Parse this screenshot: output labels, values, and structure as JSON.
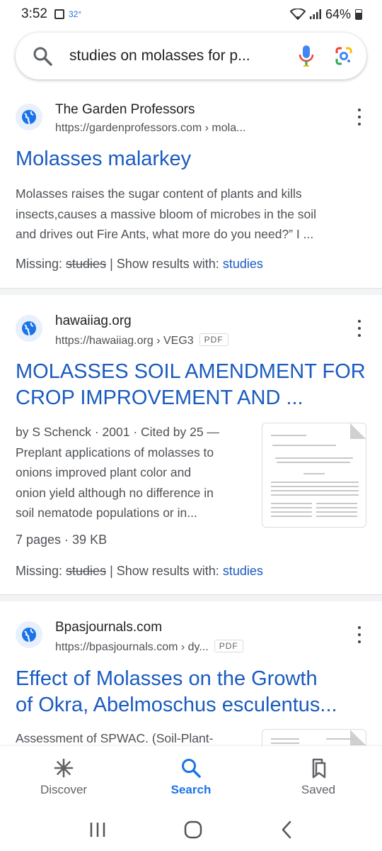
{
  "status_bar": {
    "time": "3:52",
    "temperature": "32°",
    "battery": "64%"
  },
  "search": {
    "query": "studies on molasses for p...",
    "search_icon": "search-icon",
    "mic_icon": "mic-icon",
    "lens_icon": "google-lens-icon"
  },
  "results": [
    {
      "site_name": "The Garden Professors",
      "url": "https://gardenprofessors.com › mola...",
      "title": "Molasses malarkey",
      "snippet": [
        "Molasses raises the sugar content of plants and kills",
        "insects,causes a massive bloom of microbes in the soil",
        "and drives out Fire Ants, what more do you need?” I ..."
      ],
      "missing_label": "Missing:",
      "missing_term": "studies",
      "show_results_label": " | Show results with: ",
      "show_results_link": "studies"
    },
    {
      "site_name": "hawaiiag.org",
      "url": "https://hawaiiag.org › VEG3",
      "file_type": "PDF",
      "title_lines": [
        "MOLASSES SOIL AMENDMENT FOR",
        "CROP IMPROVEMENT AND ..."
      ],
      "snippet": [
        "by S Schenck · 2001 · Cited by 25 —",
        "Preplant applications of molasses to",
        "onions improved plant color and",
        "onion yield although no difference in",
        "soil nematode populations or in..."
      ],
      "meta": "7 pages · 39 KB",
      "missing_label": "Missing:",
      "missing_term": "studies",
      "show_results_label": " | Show results with: ",
      "show_results_link": "studies"
    },
    {
      "site_name": "Bpasjournals.com",
      "url": "https://bpasjournals.com › dy...",
      "file_type": "PDF",
      "title_lines": [
        "Effect of Molasses on the Growth",
        "of Okra, Abelmoschus esculentus..."
      ],
      "snippet": [
        "Assessment of SPWAC. (Soil-Plant-"
      ]
    }
  ],
  "bottom_nav": [
    {
      "label": "Discover",
      "icon": "asterisk-icon"
    },
    {
      "label": "Search",
      "icon": "search-icon",
      "active": true
    },
    {
      "label": "Saved",
      "icon": "bookmark-icon"
    }
  ],
  "system_nav": [
    "recents-icon",
    "home-icon",
    "back-icon"
  ],
  "colors": {
    "link_blue": "#1a5bbf",
    "accent_blue": "#1a73e8",
    "text_gray": "#4d5156"
  }
}
